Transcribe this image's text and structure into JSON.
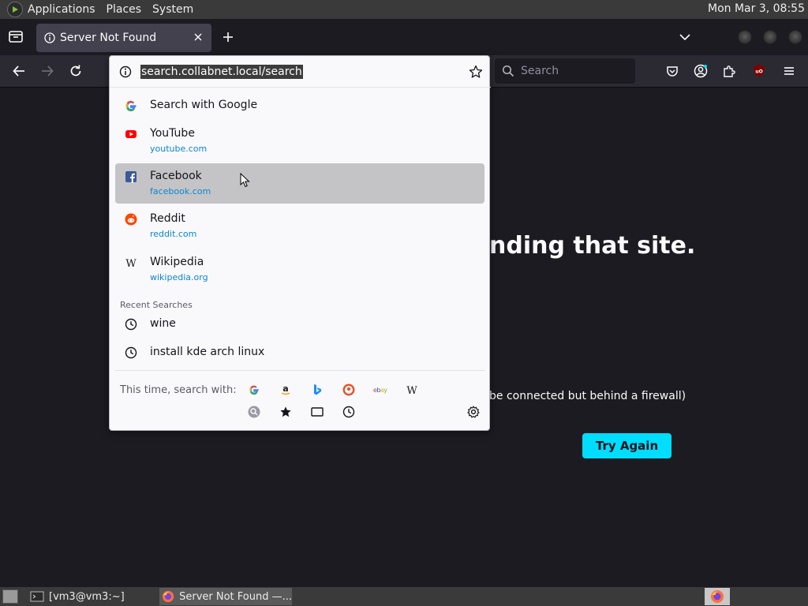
{
  "system_panel": {
    "menus": [
      "Applications",
      "Places",
      "System"
    ],
    "clock": "Mon Mar  3, 08:55"
  },
  "tabs": [
    {
      "title": "Server Not Found",
      "icon": "info-icon"
    }
  ],
  "navbar": {
    "search_placeholder": "Search"
  },
  "urlbar": {
    "value": "search.collabnet.local/search"
  },
  "dropdown": {
    "results": [
      {
        "title": "Search with Google",
        "subtitle": "",
        "icon": "google-icon"
      },
      {
        "title": "YouTube",
        "subtitle": "youtube.com",
        "icon": "youtube-icon"
      },
      {
        "title": "Facebook",
        "subtitle": "facebook.com",
        "icon": "facebook-icon",
        "selected": true
      },
      {
        "title": "Reddit",
        "subtitle": "reddit.com",
        "icon": "reddit-icon"
      },
      {
        "title": "Wikipedia",
        "subtitle": "wikipedia.org",
        "icon": "wikipedia-icon"
      }
    ],
    "recent_header": "Recent Searches",
    "recent": [
      "wine",
      "install kde arch linux"
    ],
    "oneoff_label": "This time, search with:",
    "engines": [
      "google-icon",
      "amazon-icon",
      "bing-icon",
      "duckduckgo-icon",
      "ebay-icon",
      "wikipedia-icon"
    ],
    "modes": [
      "search-engines-icon",
      "bookmarks-icon",
      "tabs-icon",
      "history-icon"
    ]
  },
  "page": {
    "error_title_fragment": "nding that site.",
    "error_line_fragment": "be connected but behind a firewall)",
    "try_again_label": "Try Again"
  },
  "taskbar": {
    "items": [
      "[vm3@vm3:~]",
      "Server Not Found —..."
    ]
  },
  "colors": {
    "accent": "#00ddff",
    "page_bg": "#1c1b22",
    "toolbar_bg": "#2b2a33",
    "link": "#0b85d4"
  }
}
